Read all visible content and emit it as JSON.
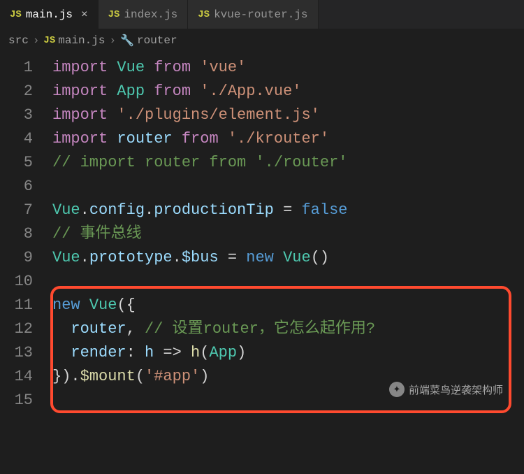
{
  "tabs": [
    {
      "icon": "JS",
      "label": "main.js",
      "active": true,
      "closeable": true
    },
    {
      "icon": "JS",
      "label": "index.js",
      "active": false,
      "closeable": false
    },
    {
      "icon": "JS",
      "label": "kvue-router.js",
      "active": false,
      "closeable": false
    }
  ],
  "breadcrumb": {
    "folder": "src",
    "fileIcon": "JS",
    "file": "main.js",
    "symbol": "router"
  },
  "lines": {
    "l1": {
      "n": "1",
      "gutter": ""
    },
    "l2": {
      "n": "2",
      "gutter": ""
    },
    "l3": {
      "n": "3",
      "gutter": ""
    },
    "l4": {
      "n": "4",
      "gutter": "yellow"
    },
    "l5": {
      "n": "5",
      "gutter": "yellow"
    },
    "l6": {
      "n": "6",
      "gutter": ""
    },
    "l7": {
      "n": "7",
      "gutter": ""
    },
    "l8": {
      "n": "8",
      "gutter": ""
    },
    "l9": {
      "n": "9",
      "gutter": ""
    },
    "l10": {
      "n": "10",
      "gutter": ""
    },
    "l11": {
      "n": "11",
      "gutter": ""
    },
    "l12": {
      "n": "12",
      "gutter": "blue"
    },
    "l13": {
      "n": "13",
      "gutter": "blue"
    },
    "l14": {
      "n": "14",
      "gutter": ""
    },
    "l15": {
      "n": "15",
      "gutter": ""
    }
  },
  "tok": {
    "import": "import",
    "from": "from",
    "new": "new",
    "false": "false",
    "Vue": "Vue",
    "App": "App",
    "router": "router",
    "render": "render",
    "h": "h",
    "config": "config",
    "productionTip": "productionTip",
    "prototype": "prototype",
    "bus": "$bus",
    "mount": "$mount",
    "s_vue": "'vue'",
    "s_appvue": "'./App.vue'",
    "s_element": "'./plugins/element.js'",
    "s_krouter": "'./krouter'",
    "s_app": "'#app'",
    "c_router": "// import router from './router'",
    "c_eventbus": "// 事件总线",
    "c_question": "// 设置router，它怎么起作用?",
    "eq": " = ",
    "dot": ".",
    "comma": ",",
    "colon": ":",
    "arrow": " => ",
    "lp": "(",
    "rp": ")",
    "lb": "{",
    "rb": "}",
    "rb_rp": "})",
    "sp": " ",
    "sp2": "  "
  },
  "watermark": "前端菜鸟逆袭架构师"
}
